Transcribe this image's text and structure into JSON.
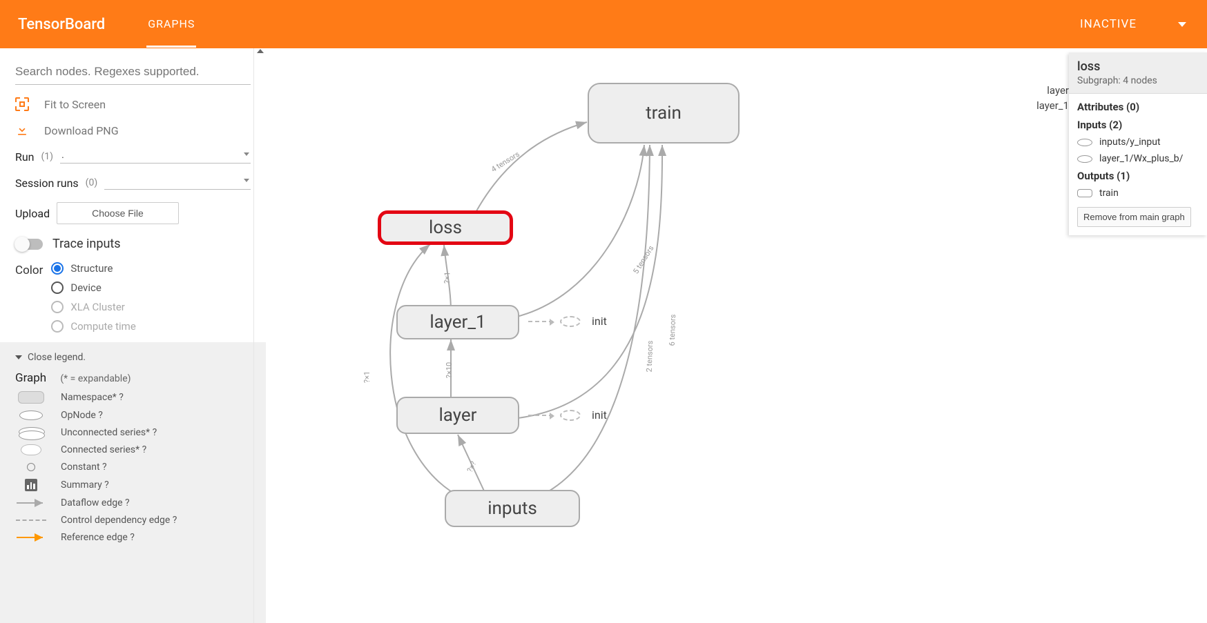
{
  "header": {
    "title": "TensorBoard",
    "tab": "GRAPHS",
    "status": "INACTIVE"
  },
  "sidebar": {
    "search_placeholder": "Search nodes. Regexes supported.",
    "fit_screen": "Fit to Screen",
    "download_png": "Download PNG",
    "run_label": "Run",
    "run_count": "(1)",
    "run_value": ".",
    "session_label": "Session runs",
    "session_count": "(0)",
    "upload_label": "Upload",
    "choose_file": "Choose File",
    "trace_inputs": "Trace inputs",
    "color_label": "Color",
    "color_options": [
      "Structure",
      "Device",
      "XLA Cluster",
      "Compute time"
    ],
    "color_selected": 0
  },
  "legend": {
    "close": "Close legend.",
    "graph_label": "Graph",
    "expandable_note": "(* = expandable)",
    "items": [
      "Namespace* ?",
      "OpNode ?",
      "Unconnected series* ?",
      "Connected series* ?",
      "Constant ?",
      "Summary ?",
      "Dataflow edge ?",
      "Control dependency edge ?",
      "Reference edge ?"
    ]
  },
  "graph": {
    "nodes": {
      "train": "train",
      "loss": "loss",
      "layer_1": "layer_1",
      "layer": "layer",
      "inputs": "inputs",
      "init": "init"
    },
    "edge_labels": {
      "loss_train": "4 tensors",
      "layer1_train": "5 tensors",
      "layer_train": "6 tensors",
      "inputs_train": "2 tensors",
      "inputs_layer": "?×?",
      "layer_layer1": "?×10",
      "inputs_loss": "?×1",
      "layer1_loss": "?×1"
    },
    "side_labels": [
      "layer",
      "layer_1"
    ]
  },
  "infocard": {
    "name": "loss",
    "subgraph": "Subgraph: 4 nodes",
    "attributes_title": "Attributes (0)",
    "inputs_title": "Inputs (2)",
    "inputs": [
      "inputs/y_input",
      "layer_1/Wx_plus_b/"
    ],
    "outputs_title": "Outputs (1)",
    "outputs": [
      "train"
    ],
    "remove": "Remove from main graph"
  }
}
